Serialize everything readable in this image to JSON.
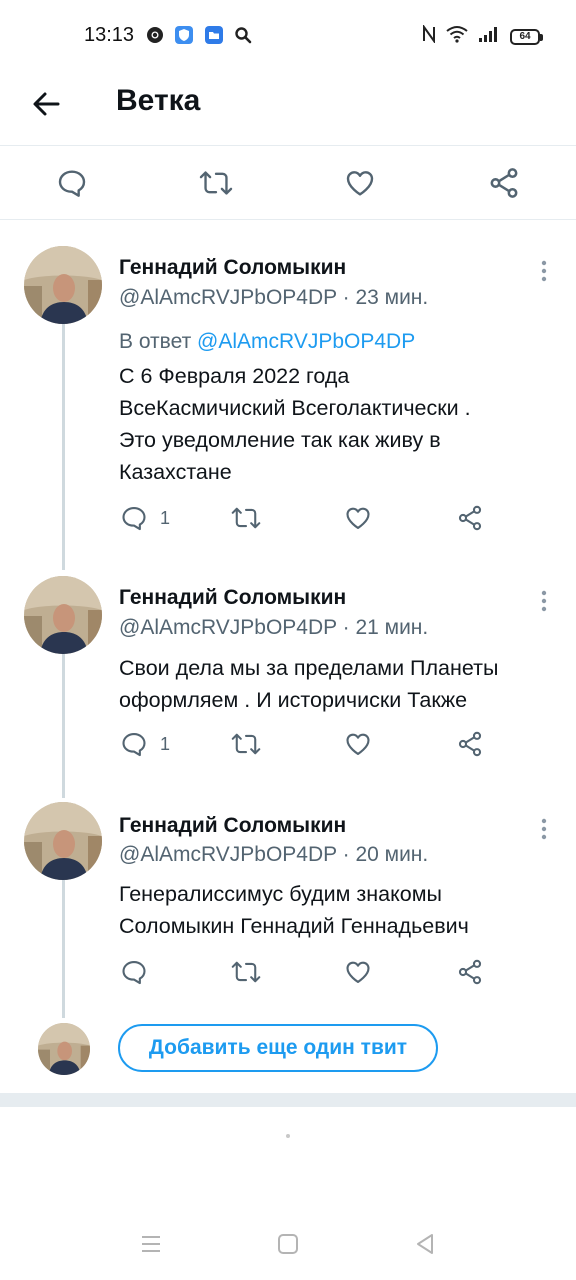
{
  "status_bar": {
    "time": "13:13",
    "battery": "64",
    "left_icons": [
      "chrome-icon",
      "shield-icon",
      "folder-icon",
      "search-icon"
    ],
    "right_icons": [
      "nfc-icon",
      "wifi-icon",
      "signal-icon",
      "battery-icon"
    ]
  },
  "header": {
    "title": "Ветка"
  },
  "tweets": [
    {
      "name": "Геннадий Соломыкин",
      "meta": "@AlAmcRVJPbOP4DP · 23 мин.",
      "reply_prefix": "В ответ ",
      "reply_handle": "@AlAmcRVJPbOP4DP",
      "text_lines": [
        "С 6 Февраля 2022 года",
        "ВсеКасмичиский Всеголактически .",
        "Это уведомление так как живу в",
        "Казахстане"
      ],
      "reply_count": "1"
    },
    {
      "name": "Геннадий Соломыкин",
      "meta": "@AlAmcRVJPbOP4DP · 21 мин.",
      "text_lines": [
        "Свои дела мы за пределами Планеты",
        "оформляем . И историчиски Также"
      ],
      "reply_count": "1"
    },
    {
      "name": "Геннадий Соломыкин",
      "meta": "@AlAmcRVJPbOP4DP · 20 мин.",
      "text_lines": [
        "Генералиссимус будим знакомы",
        "Соломыкин Геннадий Геннадьевич"
      ],
      "reply_count": ""
    }
  ],
  "add_tweet": {
    "label": "Добавить еще один твит"
  },
  "colors": {
    "accent": "#1d9bf0",
    "text": "#0f1419",
    "secondary": "#536471",
    "border": "#e6ecf0"
  }
}
